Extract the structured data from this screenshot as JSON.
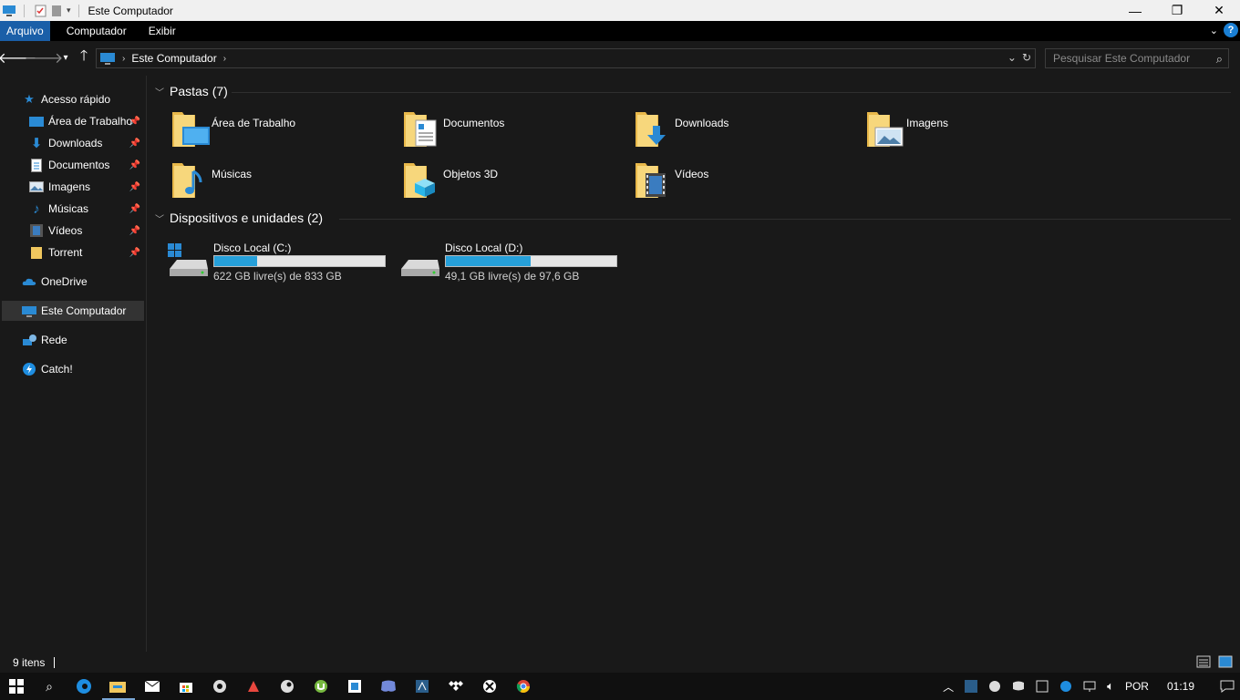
{
  "window": {
    "title": "Este Computador",
    "minimize_glyph": "—",
    "maximize_glyph": "❐",
    "close_glyph": "✕"
  },
  "ribbon": {
    "tabs": [
      {
        "label": "Arquivo",
        "active": true
      },
      {
        "label": "Computador",
        "active": false
      },
      {
        "label": "Exibir",
        "active": false
      }
    ],
    "help_label": "?"
  },
  "address": {
    "path_label": "Este Computador",
    "search_placeholder": "Pesquisar Este Computador"
  },
  "sidebar": {
    "quick_access": "Acesso rápido",
    "pinned": [
      {
        "label": "Área de Trabalho",
        "icon": "desktop-icon"
      },
      {
        "label": "Downloads",
        "icon": "download-arrow-icon"
      },
      {
        "label": "Documentos",
        "icon": "document-icon"
      },
      {
        "label": "Imagens",
        "icon": "picture-icon"
      },
      {
        "label": "Músicas",
        "icon": "music-note-icon"
      },
      {
        "label": "Vídeos",
        "icon": "film-icon"
      },
      {
        "label": "Torrent",
        "icon": "folder-icon"
      }
    ],
    "onedrive": "OneDrive",
    "this_pc": "Este Computador",
    "network": "Rede",
    "catch": "Catch!"
  },
  "content": {
    "folders_header": "Pastas (7)",
    "folders": [
      {
        "name": "Área de Trabalho",
        "overlay": "desktop"
      },
      {
        "name": "Documentos",
        "overlay": "document"
      },
      {
        "name": "Downloads",
        "overlay": "download"
      },
      {
        "name": "Imagens",
        "overlay": "picture"
      },
      {
        "name": "Músicas",
        "overlay": "music"
      },
      {
        "name": "Objetos 3D",
        "overlay": "cube"
      },
      {
        "name": "Vídeos",
        "overlay": "film"
      }
    ],
    "drives_header": "Dispositivos e unidades (2)",
    "drives": [
      {
        "name": "Disco Local (C:)",
        "free_text": "622 GB livre(s) de 833 GB",
        "used_fraction": 0.253,
        "windows": true
      },
      {
        "name": "Disco Local (D:)",
        "free_text": "49,1 GB livre(s) de 97,6 GB",
        "used_fraction": 0.497,
        "windows": false
      }
    ]
  },
  "status": {
    "items_text": "9 itens"
  },
  "taskbar": {
    "language": "POR",
    "time": "01:19"
  },
  "colors": {
    "background": "#191919",
    "ribbon_active": "#1a5fa8",
    "drive_fill": "#26a0da",
    "folder_yellow": "#f0c75e"
  }
}
